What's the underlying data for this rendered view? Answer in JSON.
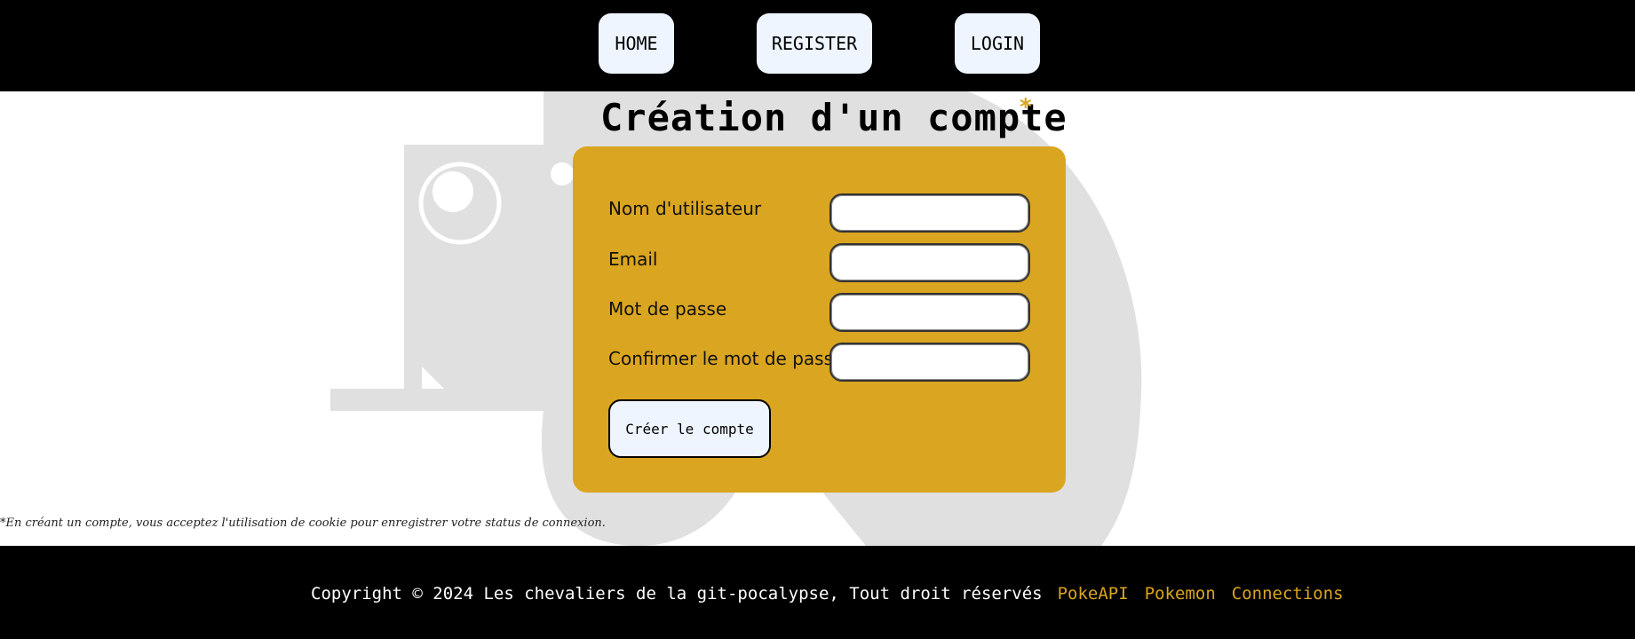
{
  "nav": {
    "home": "HOME",
    "register": "REGISTER",
    "login": "LOGIN"
  },
  "title": "Création d'un compte",
  "title_marker": "*",
  "form": {
    "fields": [
      {
        "label": "Nom d'utilisateur",
        "value": ""
      },
      {
        "label": "Email",
        "value": ""
      },
      {
        "label": "Mot de passe",
        "value": ""
      },
      {
        "label": "Confirmer le mot de passe",
        "value": ""
      }
    ],
    "submit_label": "Créer le compte"
  },
  "footnote": "*En créant un compte, vous acceptez l'utilisation de cookie pour enregistrer votre status de connexion.",
  "footer": {
    "copyright": "Copyright © 2024 Les chevaliers de la git-pocalypse, Tout droit réservés",
    "links": [
      "PokeAPI",
      "Pokemon",
      "Connections"
    ]
  },
  "colors": {
    "accent": "#daa520",
    "header_bg": "#000000",
    "button_bg": "#eef5ff",
    "silhouette": "#e0e0e0"
  }
}
